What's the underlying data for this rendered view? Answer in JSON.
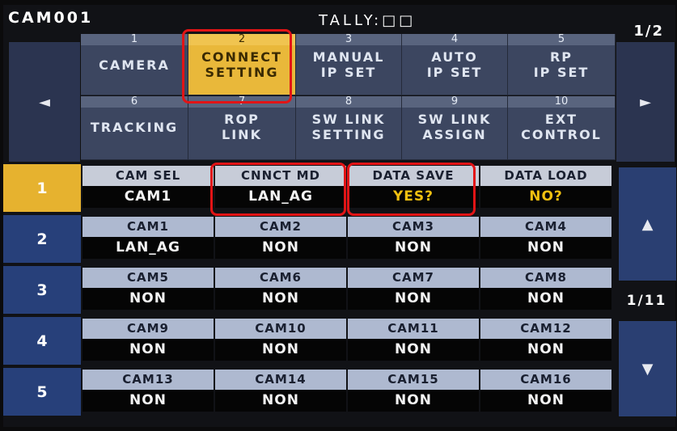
{
  "header": {
    "camera": "CAM001",
    "tally": "TALLY:□□",
    "page": "1/2"
  },
  "menu": [
    {
      "num": "1",
      "label": "CAMERA"
    },
    {
      "num": "2",
      "label": "CONNECT\nSETTING"
    },
    {
      "num": "3",
      "label": "MANUAL\nIP SET"
    },
    {
      "num": "4",
      "label": "AUTO\nIP SET"
    },
    {
      "num": "5",
      "label": "RP\nIP SET"
    },
    {
      "num": "6",
      "label": "TRACKING"
    },
    {
      "num": "7",
      "label": "ROP\nLINK"
    },
    {
      "num": "8",
      "label": "SW LINK\nSETTING"
    },
    {
      "num": "9",
      "label": "SW LINK\nASSIGN"
    },
    {
      "num": "10",
      "label": "EXT\nCONTROL"
    }
  ],
  "nav": {
    "left": "◄",
    "right": "►",
    "up": "▲",
    "down": "▼",
    "list_page": "1/11"
  },
  "rows": [
    {
      "num": "1",
      "cells": [
        {
          "h": "CAM SEL",
          "v": "CAM1"
        },
        {
          "h": "CNNCT MD",
          "v": "LAN_AG"
        },
        {
          "h": "DATA SAVE",
          "v": "YES?"
        },
        {
          "h": "DATA LOAD",
          "v": "NO?"
        }
      ]
    },
    {
      "num": "2",
      "cells": [
        {
          "h": "CAM1",
          "v": "LAN_AG"
        },
        {
          "h": "CAM2",
          "v": "NON"
        },
        {
          "h": "CAM3",
          "v": "NON"
        },
        {
          "h": "CAM4",
          "v": "NON"
        }
      ]
    },
    {
      "num": "3",
      "cells": [
        {
          "h": "CAM5",
          "v": "NON"
        },
        {
          "h": "CAM6",
          "v": "NON"
        },
        {
          "h": "CAM7",
          "v": "NON"
        },
        {
          "h": "CAM8",
          "v": "NON"
        }
      ]
    },
    {
      "num": "4",
      "cells": [
        {
          "h": "CAM9",
          "v": "NON"
        },
        {
          "h": "CAM10",
          "v": "NON"
        },
        {
          "h": "CAM11",
          "v": "NON"
        },
        {
          "h": "CAM12",
          "v": "NON"
        }
      ]
    },
    {
      "num": "5",
      "cells": [
        {
          "h": "CAM13",
          "v": "NON"
        },
        {
          "h": "CAM14",
          "v": "NON"
        },
        {
          "h": "CAM15",
          "v": "NON"
        },
        {
          "h": "CAM16",
          "v": "NON"
        }
      ]
    }
  ],
  "colors": {
    "selected": "#e9b83a",
    "highlight_box": "#e21416",
    "value_accent": "#f0c010"
  }
}
